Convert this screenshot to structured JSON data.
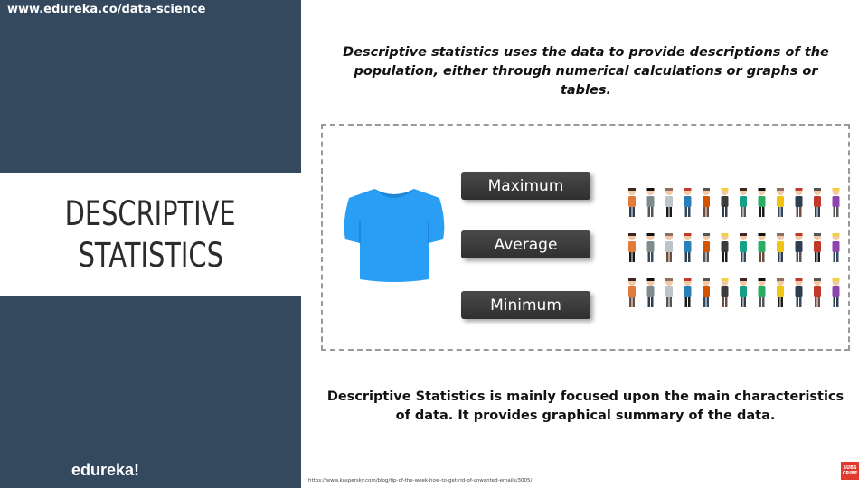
{
  "header": {
    "url": "www.edureka.co/data-science"
  },
  "title": {
    "line1": "DESCRIPTIVE",
    "line2": "STATISTICS"
  },
  "brand": {
    "logo": "edureka!"
  },
  "intro": "Descriptive statistics uses the data to provide descriptions of the population, either through numerical calculations or graphs or tables.",
  "diagram": {
    "labels": {
      "max": "Maximum",
      "avg": "Average",
      "min": "Minimum"
    },
    "tshirt_color": "#2a9df4"
  },
  "summary": "Descriptive Statistics is mainly focused upon the main characteristics of data. It provides graphical summary of the data.",
  "footer": {
    "source": "https://www.kaspersky.com/blog/tip-of-the-week-how-to-get-rid-of-unwanted-emails/3005/",
    "subscribe": "SUBS CRIBE"
  },
  "colors": {
    "panel": "#34485e",
    "button": "#3a3a3a"
  }
}
